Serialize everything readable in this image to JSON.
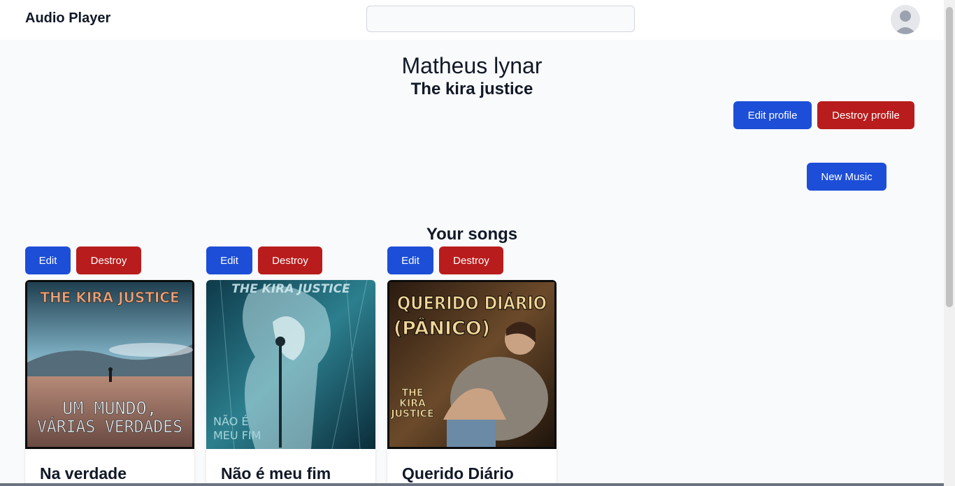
{
  "app": {
    "title": "Audio Player"
  },
  "search": {
    "value": "",
    "placeholder": ""
  },
  "profile": {
    "name": "Matheus lynar",
    "band": "The kira justice",
    "edit_label": "Edit profile",
    "destroy_label": "Destroy profile"
  },
  "actions": {
    "new_music_label": "New Music"
  },
  "songs_section": {
    "title": "Your songs"
  },
  "songs": [
    {
      "title": "Na verdade",
      "edit_label": "Edit",
      "destroy_label": "Destroy",
      "cover_text": {
        "top": "THE KIRA JUSTICE",
        "line1": "UM MUNDO,",
        "line2": "VÁRIAS VERDADES"
      }
    },
    {
      "title": "Não é meu fim",
      "edit_label": "Edit",
      "destroy_label": "Destroy",
      "cover_text": {
        "top": "THE KIRA JUSTICE",
        "line1": "NÃO É",
        "line2": "MEU FIM"
      }
    },
    {
      "title": "Querido Diário",
      "edit_label": "Edit",
      "destroy_label": "Destroy",
      "cover_text": {
        "top": "QUERIDO DIÁRIO",
        "line1": "(PÂNICO)",
        "line2": "THE",
        "line3": "KIRA",
        "line4": "JUSTICE"
      }
    }
  ],
  "colors": {
    "primary": "#1d4ed8",
    "danger": "#b91c1c",
    "background": "#f9fafb"
  },
  "icons": {
    "avatar": "user-avatar-icon"
  }
}
